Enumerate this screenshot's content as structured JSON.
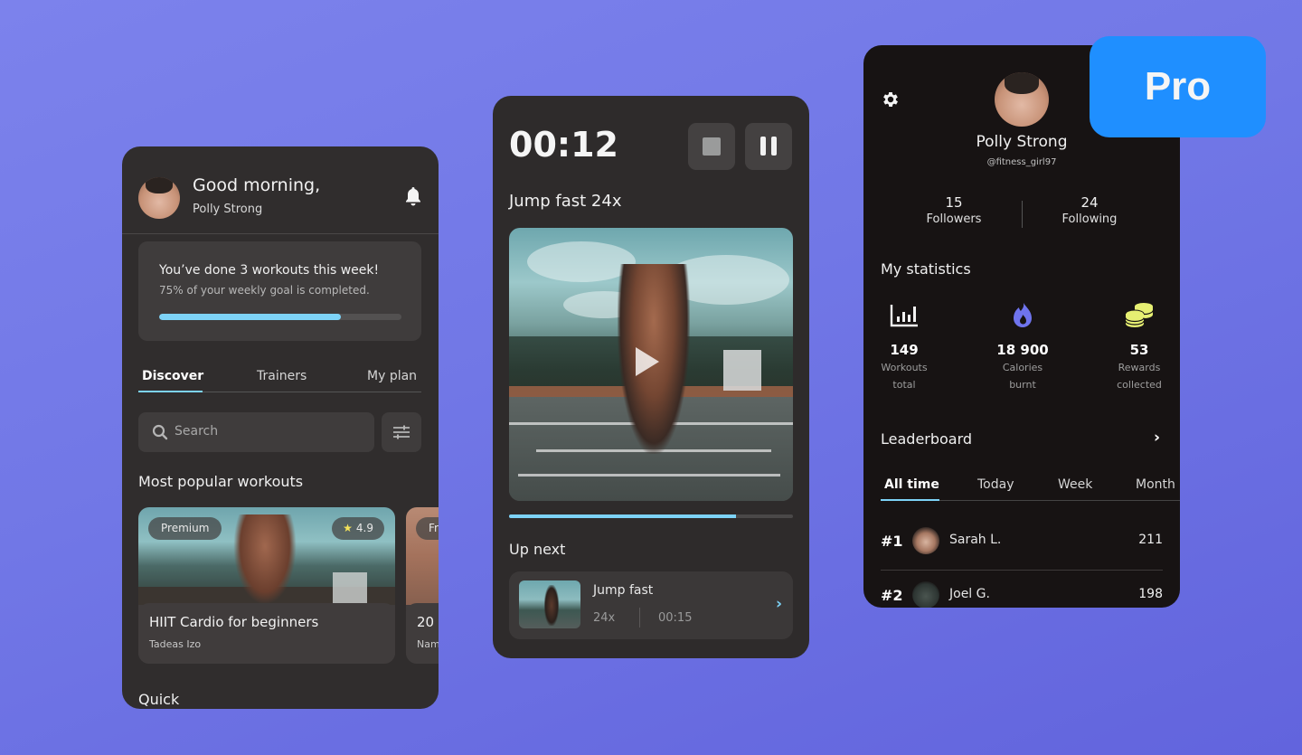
{
  "background_color": "#7177e6",
  "accent_color": "#7dd3f7",
  "home_screen": {
    "greeting": "Good morning,",
    "user_name": "Polly Strong",
    "weekly_goal": {
      "title": "You’ve done 3 workouts this week!",
      "subtitle": "75% of your weekly goal is completed.",
      "progress_percent": 75
    },
    "tabs": [
      {
        "label": "Discover",
        "active": true
      },
      {
        "label": "Trainers",
        "active": false
      },
      {
        "label": "My plan",
        "active": false
      }
    ],
    "search": {
      "placeholder": "Search"
    },
    "popular_heading": "Most popular workouts",
    "workouts": [
      {
        "badge": "Premium",
        "rating": "4.9",
        "title": "HIIT Cardio for beginners",
        "author": "Tadeas Izo"
      },
      {
        "badge": "Fr",
        "title": "20",
        "author": "Nam"
      }
    ],
    "quick_heading": "Quick"
  },
  "player_screen": {
    "timer": "00:12",
    "exercise_title": "Jump fast 24x",
    "video_progress_percent": 80,
    "up_next_heading": "Up next",
    "next_item": {
      "title": "Jump fast",
      "reps": "24x",
      "duration": "00:15"
    }
  },
  "profile_screen": {
    "name": "Polly Strong",
    "handle": "@fitness_girl97",
    "followers": {
      "count": "15",
      "label": "Followers"
    },
    "following": {
      "count": "24",
      "label": "Following"
    },
    "statistics_heading": "My statistics",
    "stats": [
      {
        "icon": "bar-chart-icon",
        "value": "149",
        "label_1": "Workouts",
        "label_2": "total"
      },
      {
        "icon": "flame-icon",
        "value": "18 900",
        "label_1": "Calories",
        "label_2": "burnt"
      },
      {
        "icon": "coins-icon",
        "value": "53",
        "label_1": "Rewards",
        "label_2": "collected"
      }
    ],
    "leaderboard_heading": "Leaderboard",
    "leaderboard_tabs": [
      {
        "label": "All time",
        "active": true
      },
      {
        "label": "Today",
        "active": false
      },
      {
        "label": "Week",
        "active": false
      },
      {
        "label": "Month",
        "active": false
      }
    ],
    "leaderboard": [
      {
        "rank": "#1",
        "name": "Sarah L.",
        "score": "211"
      },
      {
        "rank": "#2",
        "name": "Joel G.",
        "score": "198"
      }
    ]
  },
  "pro_badge": {
    "label": "Pro",
    "color": "#1f8fff"
  }
}
